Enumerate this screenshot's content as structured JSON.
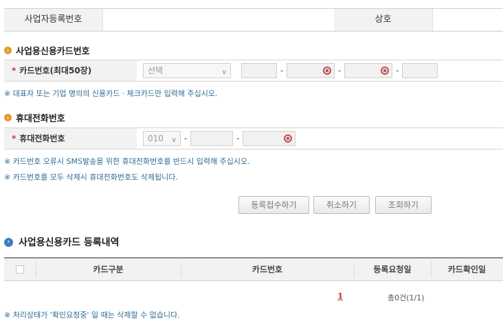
{
  "info": {
    "business_no_label": "사업자등록번호",
    "business_no_value": "",
    "company_label": "상호",
    "company_value": ""
  },
  "card_section": {
    "title": "사업용신용카드번호",
    "field_label": "카드번호(최대50장)",
    "select_value": "선택",
    "note": "※ 대표자 또는 기업 명의의 신용카드ㆍ체크카드만 입력해 주십시오."
  },
  "phone_section": {
    "title": "휴대전화번호",
    "field_label": "휴대전화번호",
    "prefix_value": "010",
    "notes": [
      "※ 카드번호 오류시 SMS발송을 위한 휴대전화번호를 반드시 입력해 주십시오.",
      "※ 카드번호를 모두 삭제시 휴대전화번호도 삭제됩니다."
    ]
  },
  "buttons": {
    "register": "등록접수하기",
    "cancel": "취소하기",
    "inquiry": "조회하기"
  },
  "list_section": {
    "title": "사업용신용카드 등록내역",
    "columns": [
      "카드구분",
      "카드번호",
      "등록요청일",
      "카드확인일"
    ],
    "page_link": "1",
    "count_text": "총0건(1/1)",
    "note": "※ 처리상태가 '확인요청중' 일 때는 삭제할 수 없습니다."
  },
  "colors": {
    "accent_orange": "#e49a2c",
    "accent_blue": "#3c7cc3",
    "note_text": "#2f6b93",
    "required": "#c0392b"
  }
}
